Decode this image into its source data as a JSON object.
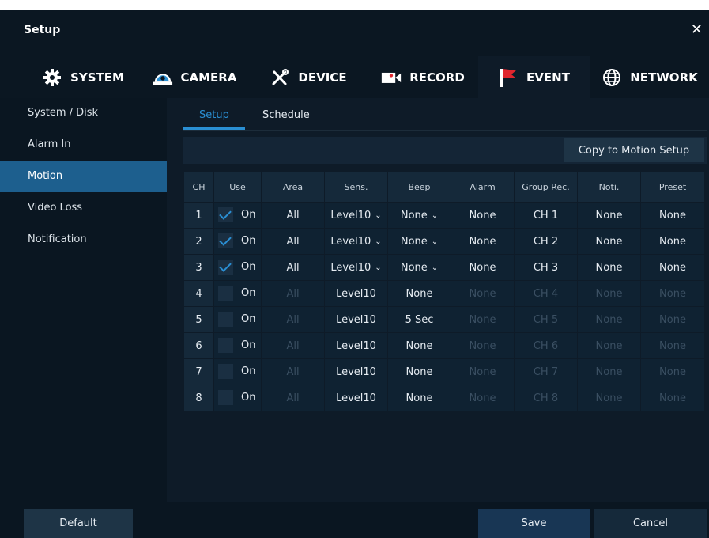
{
  "window": {
    "title": "Setup"
  },
  "tabs": [
    {
      "label": "SYSTEM",
      "icon": "gear-icon"
    },
    {
      "label": "CAMERA",
      "icon": "camera-dome-icon"
    },
    {
      "label": "DEVICE",
      "icon": "tools-icon"
    },
    {
      "label": "RECORD",
      "icon": "record-camera-icon"
    },
    {
      "label": "EVENT",
      "icon": "flag-icon",
      "active": true
    },
    {
      "label": "NETWORK",
      "icon": "globe-icon"
    }
  ],
  "sidebar": {
    "items": [
      {
        "label": "System / Disk"
      },
      {
        "label": "Alarm In"
      },
      {
        "label": "Motion",
        "active": true
      },
      {
        "label": "Video Loss"
      },
      {
        "label": "Notification"
      }
    ]
  },
  "subtabs": [
    {
      "label": "Setup",
      "active": true
    },
    {
      "label": "Schedule"
    }
  ],
  "copy_button": "Copy to Motion Setup",
  "table": {
    "headers": [
      "CH",
      "Use",
      "Area",
      "Sens.",
      "Beep",
      "Alarm",
      "Group Rec.",
      "Noti.",
      "Preset"
    ],
    "rows": [
      {
        "ch": "1",
        "checked": true,
        "use": "On",
        "area": "All",
        "sens": "Level10",
        "beep": "None",
        "alarm": "None",
        "group": "CH 1",
        "noti": "None",
        "preset": "None"
      },
      {
        "ch": "2",
        "checked": true,
        "use": "On",
        "area": "All",
        "sens": "Level10",
        "beep": "None",
        "alarm": "None",
        "group": "CH 2",
        "noti": "None",
        "preset": "None"
      },
      {
        "ch": "3",
        "checked": true,
        "use": "On",
        "area": "All",
        "sens": "Level10",
        "beep": "None",
        "alarm": "None",
        "group": "CH 3",
        "noti": "None",
        "preset": "None"
      },
      {
        "ch": "4",
        "checked": false,
        "use": "On",
        "area": "All",
        "sens": "Level10",
        "beep": "None",
        "alarm": "None",
        "group": "CH 4",
        "noti": "None",
        "preset": "None"
      },
      {
        "ch": "5",
        "checked": false,
        "use": "On",
        "area": "All",
        "sens": "Level10",
        "beep": "5 Sec",
        "alarm": "None",
        "group": "CH 5",
        "noti": "None",
        "preset": "None"
      },
      {
        "ch": "6",
        "checked": false,
        "use": "On",
        "area": "All",
        "sens": "Level10",
        "beep": "None",
        "alarm": "None",
        "group": "CH 6",
        "noti": "None",
        "preset": "None"
      },
      {
        "ch": "7",
        "checked": false,
        "use": "On",
        "area": "All",
        "sens": "Level10",
        "beep": "None",
        "alarm": "None",
        "group": "CH 7",
        "noti": "None",
        "preset": "None"
      },
      {
        "ch": "8",
        "checked": false,
        "use": "On",
        "area": "All",
        "sens": "Level10",
        "beep": "None",
        "alarm": "None",
        "group": "CH 8",
        "noti": "None",
        "preset": "None"
      }
    ]
  },
  "footer": {
    "default_label": "Default",
    "save_label": "Save",
    "cancel_label": "Cancel"
  },
  "colors": {
    "accent": "#2a8fd3",
    "active_sidebar": "#1d5f8e",
    "flag": "#e0262e"
  }
}
